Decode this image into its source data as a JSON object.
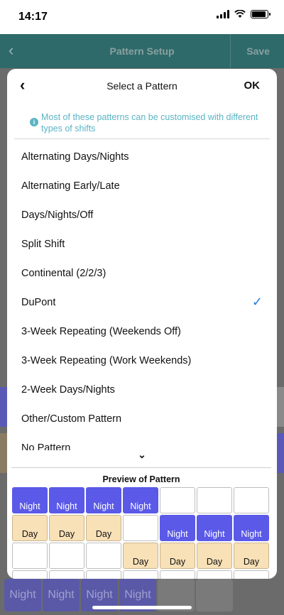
{
  "status": {
    "time": "14:17"
  },
  "background": {
    "title": "Pattern Setup",
    "save_label": "Save",
    "bottom_cells": [
      "Night",
      "Night",
      "Night",
      "Night",
      "",
      ""
    ]
  },
  "modal": {
    "title": "Select a Pattern",
    "ok_label": "OK",
    "info_text": "Most of these patterns can be customised with different types of shifts",
    "patterns": [
      {
        "label": "Alternating Days/Nights",
        "selected": false
      },
      {
        "label": "Alternating Early/Late",
        "selected": false
      },
      {
        "label": "Days/Nights/Off",
        "selected": false
      },
      {
        "label": "Split Shift",
        "selected": false
      },
      {
        "label": "Continental (2/2/3)",
        "selected": false
      },
      {
        "label": "DuPont",
        "selected": true
      },
      {
        "label": "3-Week Repeating (Weekends Off)",
        "selected": false
      },
      {
        "label": "3-Week Repeating (Work Weekends)",
        "selected": false
      },
      {
        "label": "2-Week Days/Nights",
        "selected": false
      },
      {
        "label": "Other/Custom Pattern",
        "selected": false
      },
      {
        "label": "No Pattern",
        "selected": false
      }
    ],
    "preview": {
      "title": "Preview of Pattern",
      "rows": [
        [
          "Night",
          "Night",
          "Night",
          "Night",
          "",
          "",
          ""
        ],
        [
          "Day",
          "Day",
          "Day",
          "",
          "Night",
          "Night",
          "Night"
        ],
        [
          "",
          "",
          "",
          "Day",
          "Day",
          "Day",
          "Day"
        ],
        [
          "",
          "",
          "",
          "",
          "",
          "",
          ""
        ]
      ]
    }
  },
  "colors": {
    "night": "#5a59e8",
    "day": "#f8e0b7",
    "accent": "#2f7de0",
    "info": "#5ab4c4"
  }
}
